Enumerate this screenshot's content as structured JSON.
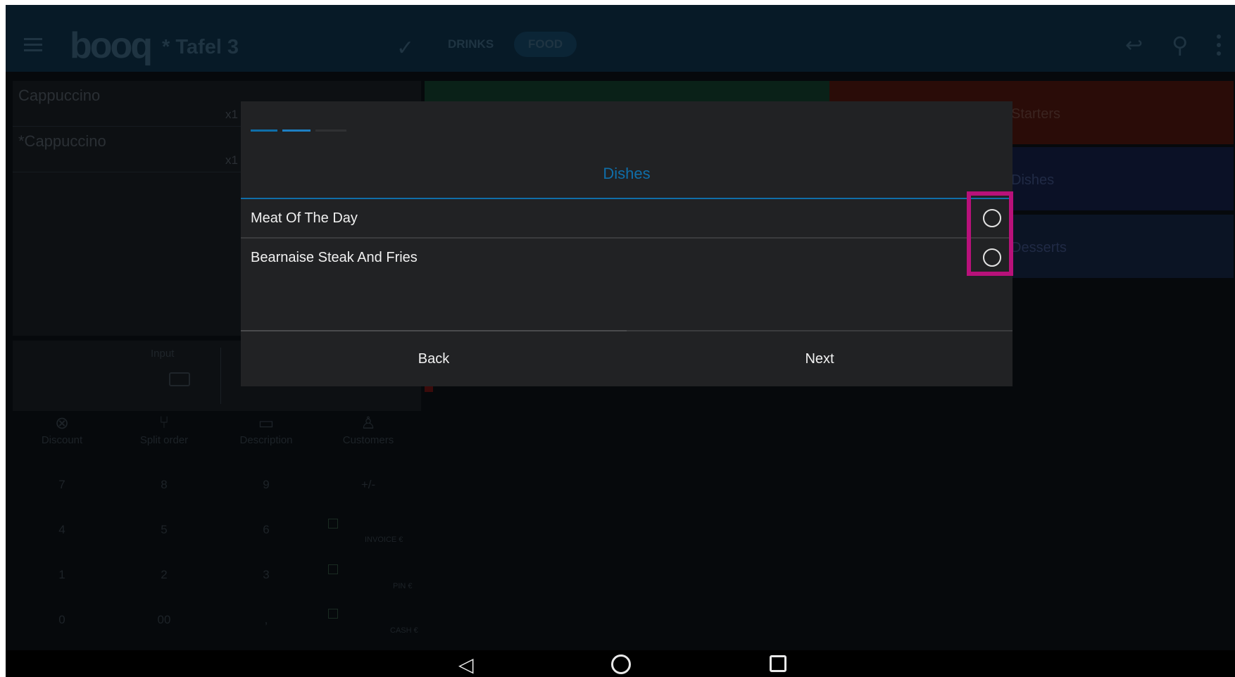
{
  "topbar": {
    "logo": "booq",
    "table_title": "* Tafel 3",
    "tabs": [
      {
        "label": "DRINKS"
      },
      {
        "label": "FOOD"
      }
    ],
    "icons": [
      "hamburger-icon",
      "check-icon",
      "undo-icon",
      "search-icon",
      "more-icon"
    ]
  },
  "order": {
    "items": [
      {
        "name": "Cappuccino",
        "qty": "x1"
      },
      {
        "name": "*Cappuccino",
        "qty": "x1"
      }
    ]
  },
  "input": {
    "label": "Input"
  },
  "actions": [
    {
      "label": "Discount",
      "icon": "discount-icon"
    },
    {
      "label": "Split order",
      "icon": "split-icon"
    },
    {
      "label": "Description",
      "icon": "description-icon"
    },
    {
      "label": "Customers",
      "icon": "customers-icon"
    }
  ],
  "numpad": {
    "keys": [
      "7",
      "8",
      "9",
      "+/-",
      "4",
      "5",
      "6",
      "1",
      "2",
      "3",
      "0",
      "00",
      ","
    ],
    "payments": [
      "INVOICE €",
      "PIN €",
      "CASH €"
    ]
  },
  "tiles": {
    "starters": "Starters",
    "dishes": "Dishes",
    "desserts": "Desserts"
  },
  "modal": {
    "title": "Dishes",
    "options": [
      {
        "label": "Meat Of The Day",
        "selected": false
      },
      {
        "label": "Bearnaise Steak And Fries",
        "selected": false
      }
    ],
    "back_label": "Back",
    "next_label": "Next",
    "progress_steps": 3,
    "progress_current": 2
  },
  "colors": {
    "accent": "#0f6ea9",
    "highlight": "#b8117a",
    "modal_bg": "#212224"
  },
  "navbar": {
    "icons": [
      "nav-back-icon",
      "nav-home-icon",
      "nav-recent-icon"
    ]
  }
}
